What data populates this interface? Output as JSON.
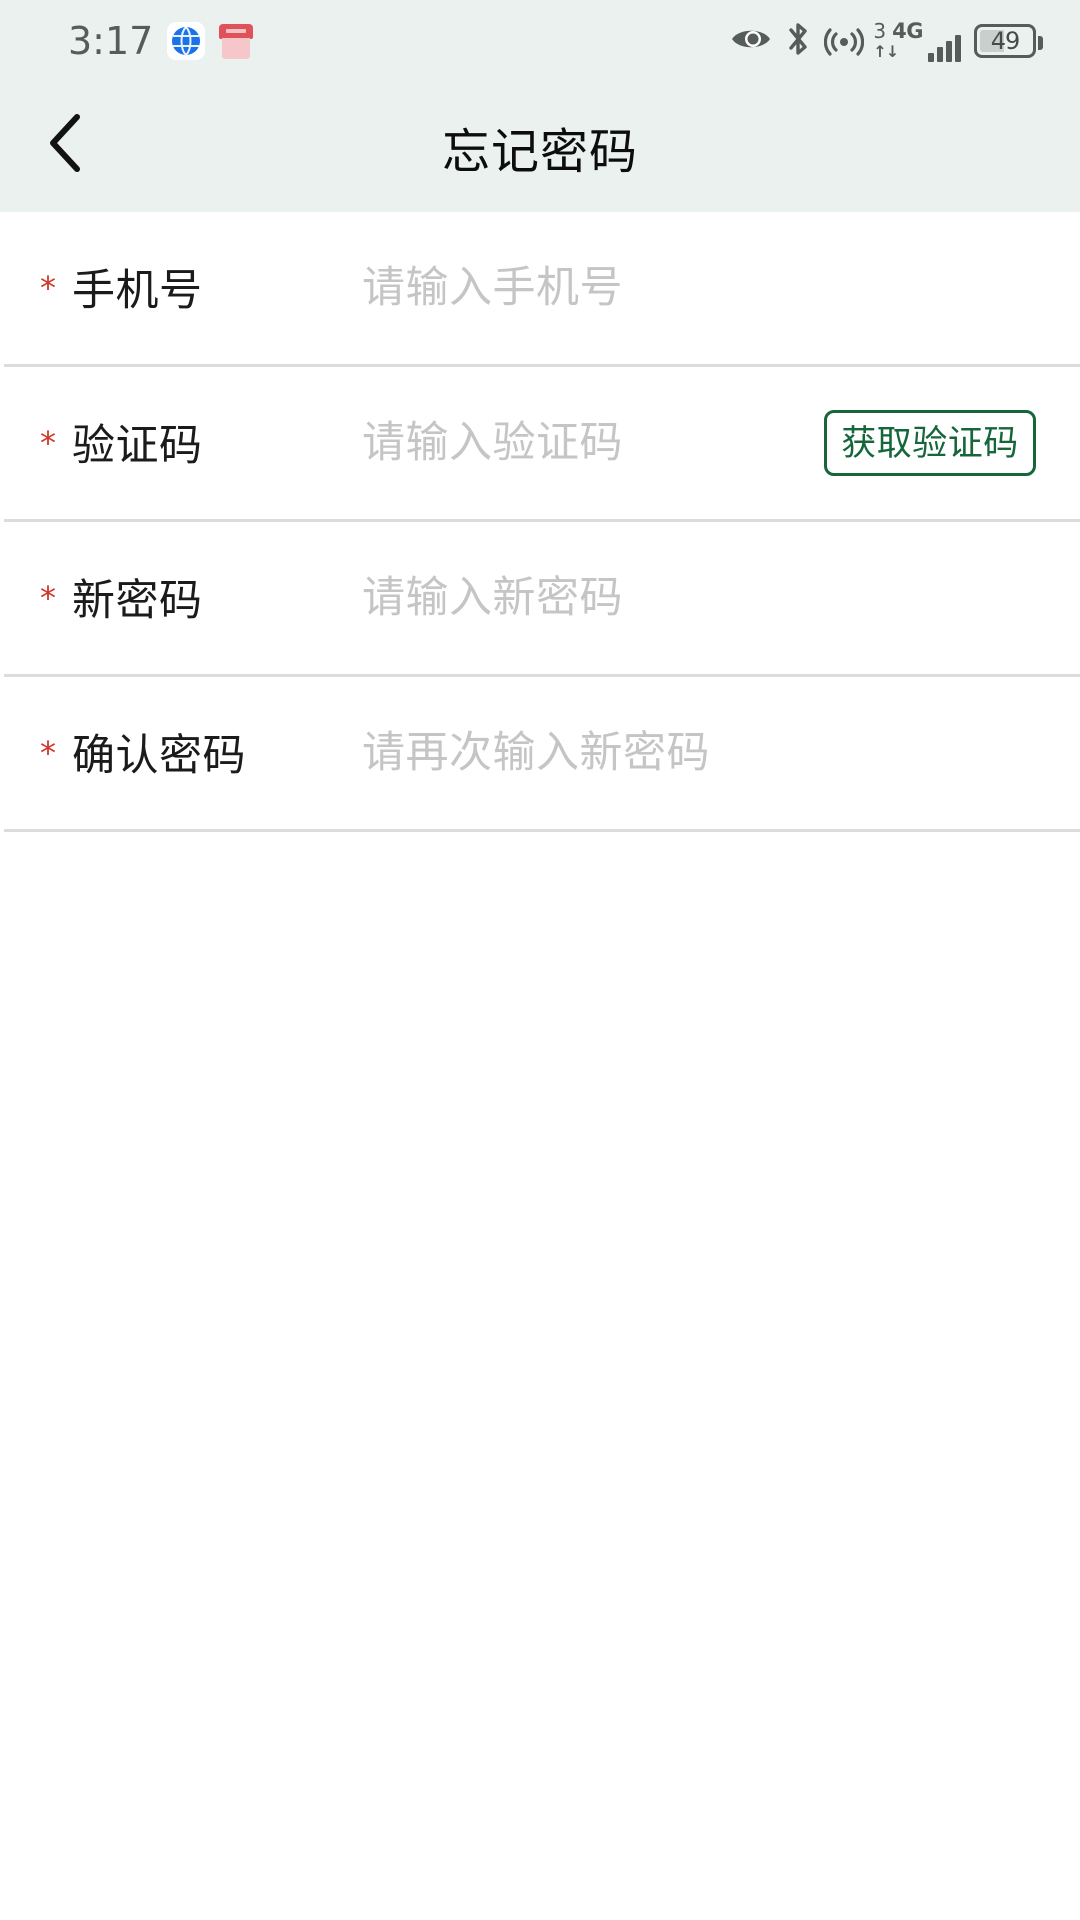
{
  "status_bar": {
    "time": "3:17",
    "battery_percent": "49",
    "network_generation": "3",
    "network_type": "4G",
    "data_arrows": "↑↓",
    "icons": [
      "globe-app-icon",
      "red-app-icon",
      "eye-icon",
      "bluetooth-icon",
      "hotspot-icon",
      "signal-bars-icon",
      "battery-icon"
    ],
    "colors": {
      "bar_background": "#eaf1ef",
      "icon_gray": "#555c5a",
      "globe_blue": "#1a73e8",
      "app_red": "#e0525a"
    }
  },
  "header": {
    "title": "忘记密码",
    "back_icon": "chevron-left-icon",
    "background": "#eaf1ef"
  },
  "form": {
    "required_marker": "*",
    "rows": [
      {
        "label": "手机号",
        "placeholder": "请输入手机号",
        "value": "",
        "required": true,
        "has_button": false
      },
      {
        "label": "验证码",
        "placeholder": "请输入验证码",
        "value": "",
        "required": true,
        "has_button": true,
        "button_label": "获取验证码"
      },
      {
        "label": "新密码",
        "placeholder": "请输入新密码",
        "value": "",
        "required": true,
        "has_button": false
      },
      {
        "label": "确认密码",
        "placeholder": "请再次输入新密码",
        "value": "",
        "required": true,
        "has_button": false
      }
    ],
    "colors": {
      "required_star": "#d0362a",
      "label_text": "#1b1b1b",
      "placeholder_text": "#c5c5c5",
      "divider": "#dcdcdc",
      "button_green": "#15663a",
      "background": "#ffffff"
    }
  }
}
